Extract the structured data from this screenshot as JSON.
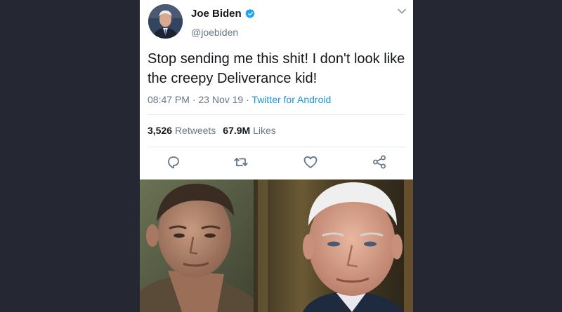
{
  "tweet": {
    "name": "Joe Biden",
    "handle": "@joebiden",
    "text": "Stop sending me this shit! I don't look like the creepy Deliverance kid!",
    "time": "08:47 PM",
    "date": "23 Nov 19",
    "source": "Twitter for Android",
    "retweets_count": "3,526",
    "retweets_label": "Retweets",
    "likes_count": "67.9M",
    "likes_label": "Likes"
  },
  "icons": {
    "verified": "verified-badge-icon",
    "more": "chevron-down-icon",
    "reply": "reply-icon",
    "retweet": "retweet-icon",
    "like": "heart-icon",
    "share": "share-icon"
  },
  "colors": {
    "background": "#252833",
    "link": "#1b95e0",
    "icon": "#657786"
  }
}
